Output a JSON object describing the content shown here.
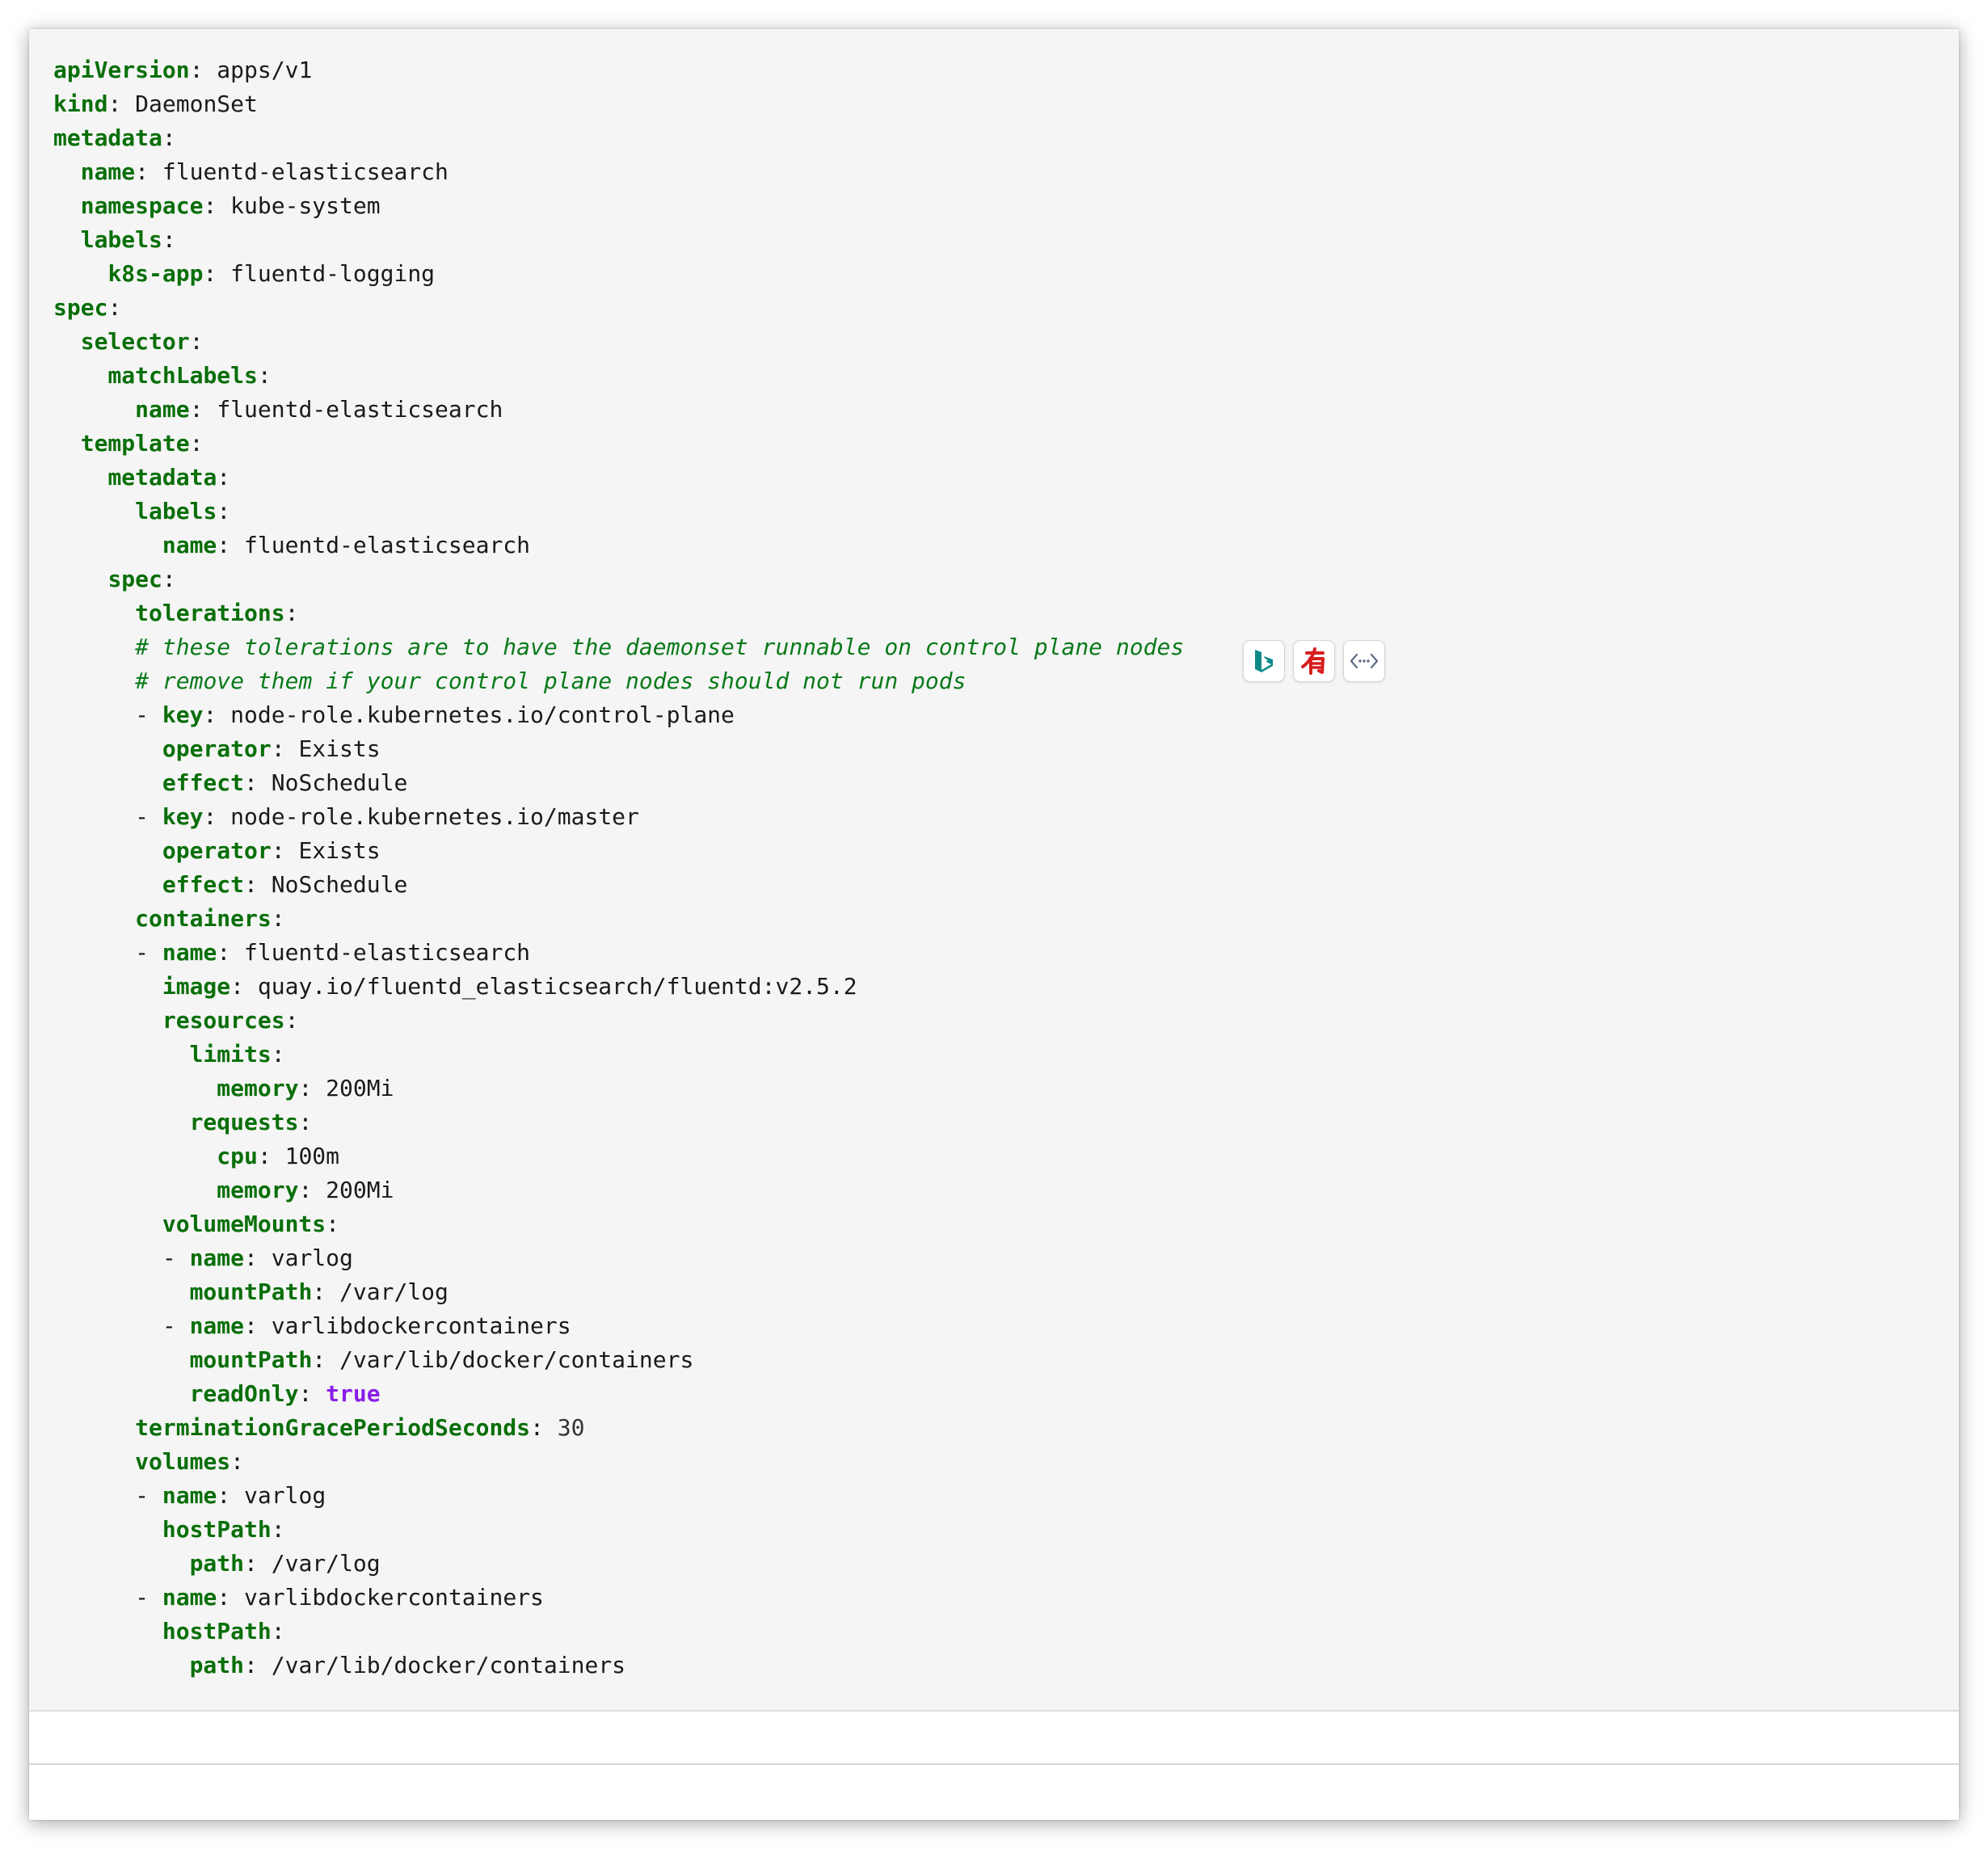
{
  "code": {
    "language": "yaml",
    "lines": [
      {
        "indent": "",
        "dash": "",
        "key": "apiVersion",
        "sep": ": ",
        "value": "apps/v1",
        "value_type": "str"
      },
      {
        "indent": "",
        "dash": "",
        "key": "kind",
        "sep": ": ",
        "value": "DaemonSet",
        "value_type": "str"
      },
      {
        "indent": "",
        "dash": "",
        "key": "metadata",
        "sep": ":",
        "value": "",
        "value_type": "str"
      },
      {
        "indent": "  ",
        "dash": "",
        "key": "name",
        "sep": ": ",
        "value": "fluentd-elasticsearch",
        "value_type": "str"
      },
      {
        "indent": "  ",
        "dash": "",
        "key": "namespace",
        "sep": ": ",
        "value": "kube-system",
        "value_type": "str"
      },
      {
        "indent": "  ",
        "dash": "",
        "key": "labels",
        "sep": ":",
        "value": "",
        "value_type": "str"
      },
      {
        "indent": "    ",
        "dash": "",
        "key": "k8s-app",
        "sep": ": ",
        "value": "fluentd-logging",
        "value_type": "str"
      },
      {
        "indent": "",
        "dash": "",
        "key": "spec",
        "sep": ":",
        "value": "",
        "value_type": "str"
      },
      {
        "indent": "  ",
        "dash": "",
        "key": "selector",
        "sep": ":",
        "value": "",
        "value_type": "str"
      },
      {
        "indent": "    ",
        "dash": "",
        "key": "matchLabels",
        "sep": ":",
        "value": "",
        "value_type": "str"
      },
      {
        "indent": "      ",
        "dash": "",
        "key": "name",
        "sep": ": ",
        "value": "fluentd-elasticsearch",
        "value_type": "str"
      },
      {
        "indent": "  ",
        "dash": "",
        "key": "template",
        "sep": ":",
        "value": "",
        "value_type": "str"
      },
      {
        "indent": "    ",
        "dash": "",
        "key": "metadata",
        "sep": ":",
        "value": "",
        "value_type": "str"
      },
      {
        "indent": "      ",
        "dash": "",
        "key": "labels",
        "sep": ":",
        "value": "",
        "value_type": "str"
      },
      {
        "indent": "        ",
        "dash": "",
        "key": "name",
        "sep": ": ",
        "value": "fluentd-elasticsearch",
        "value_type": "str"
      },
      {
        "indent": "    ",
        "dash": "",
        "key": "spec",
        "sep": ":",
        "value": "",
        "value_type": "str"
      },
      {
        "indent": "      ",
        "dash": "",
        "key": "tolerations",
        "sep": ":",
        "value": "",
        "value_type": "str"
      },
      {
        "indent": "      ",
        "comment": "# these tolerations are to have the daemonset runnable on control plane nodes"
      },
      {
        "indent": "      ",
        "comment": "# remove them if your control plane nodes should not run pods"
      },
      {
        "indent": "      ",
        "dash": "- ",
        "key": "key",
        "sep": ": ",
        "value": "node-role.kubernetes.io/control-plane",
        "value_type": "str"
      },
      {
        "indent": "        ",
        "dash": "",
        "key": "operator",
        "sep": ": ",
        "value": "Exists",
        "value_type": "str"
      },
      {
        "indent": "        ",
        "dash": "",
        "key": "effect",
        "sep": ": ",
        "value": "NoSchedule",
        "value_type": "str"
      },
      {
        "indent": "      ",
        "dash": "- ",
        "key": "key",
        "sep": ": ",
        "value": "node-role.kubernetes.io/master",
        "value_type": "str"
      },
      {
        "indent": "        ",
        "dash": "",
        "key": "operator",
        "sep": ": ",
        "value": "Exists",
        "value_type": "str"
      },
      {
        "indent": "        ",
        "dash": "",
        "key": "effect",
        "sep": ": ",
        "value": "NoSchedule",
        "value_type": "str"
      },
      {
        "indent": "      ",
        "dash": "",
        "key": "containers",
        "sep": ":",
        "value": "",
        "value_type": "str"
      },
      {
        "indent": "      ",
        "dash": "- ",
        "key": "name",
        "sep": ": ",
        "value": "fluentd-elasticsearch",
        "value_type": "str"
      },
      {
        "indent": "        ",
        "dash": "",
        "key": "image",
        "sep": ": ",
        "value": "quay.io/fluentd_elasticsearch/fluentd:v2.5.2",
        "value_type": "str"
      },
      {
        "indent": "        ",
        "dash": "",
        "key": "resources",
        "sep": ":",
        "value": "",
        "value_type": "str"
      },
      {
        "indent": "          ",
        "dash": "",
        "key": "limits",
        "sep": ":",
        "value": "",
        "value_type": "str"
      },
      {
        "indent": "            ",
        "dash": "",
        "key": "memory",
        "sep": ": ",
        "value": "200Mi",
        "value_type": "str"
      },
      {
        "indent": "          ",
        "dash": "",
        "key": "requests",
        "sep": ":",
        "value": "",
        "value_type": "str"
      },
      {
        "indent": "            ",
        "dash": "",
        "key": "cpu",
        "sep": ": ",
        "value": "100m",
        "value_type": "str"
      },
      {
        "indent": "            ",
        "dash": "",
        "key": "memory",
        "sep": ": ",
        "value": "200Mi",
        "value_type": "str"
      },
      {
        "indent": "        ",
        "dash": "",
        "key": "volumeMounts",
        "sep": ":",
        "value": "",
        "value_type": "str"
      },
      {
        "indent": "        ",
        "dash": "- ",
        "key": "name",
        "sep": ": ",
        "value": "varlog",
        "value_type": "str"
      },
      {
        "indent": "          ",
        "dash": "",
        "key": "mountPath",
        "sep": ": ",
        "value": "/var/log",
        "value_type": "str"
      },
      {
        "indent": "        ",
        "dash": "- ",
        "key": "name",
        "sep": ": ",
        "value": "varlibdockercontainers",
        "value_type": "str"
      },
      {
        "indent": "          ",
        "dash": "",
        "key": "mountPath",
        "sep": ": ",
        "value": "/var/lib/docker/containers",
        "value_type": "str"
      },
      {
        "indent": "          ",
        "dash": "",
        "key": "readOnly",
        "sep": ": ",
        "value": "true",
        "value_type": "bool"
      },
      {
        "indent": "      ",
        "dash": "",
        "key": "terminationGracePeriodSeconds",
        "sep": ": ",
        "value": "30",
        "value_type": "num"
      },
      {
        "indent": "      ",
        "dash": "",
        "key": "volumes",
        "sep": ":",
        "value": "",
        "value_type": "str"
      },
      {
        "indent": "      ",
        "dash": "- ",
        "key": "name",
        "sep": ": ",
        "value": "varlog",
        "value_type": "str"
      },
      {
        "indent": "        ",
        "dash": "",
        "key": "hostPath",
        "sep": ":",
        "value": "",
        "value_type": "str"
      },
      {
        "indent": "          ",
        "dash": "",
        "key": "path",
        "sep": ": ",
        "value": "/var/log",
        "value_type": "str"
      },
      {
        "indent": "      ",
        "dash": "- ",
        "key": "name",
        "sep": ": ",
        "value": "varlibdockercontainers",
        "value_type": "str"
      },
      {
        "indent": "        ",
        "dash": "",
        "key": "hostPath",
        "sep": ":",
        "value": "",
        "value_type": "str"
      },
      {
        "indent": "          ",
        "dash": "",
        "key": "path",
        "sep": ": ",
        "value": "/var/lib/docker/containers",
        "value_type": "str"
      }
    ]
  },
  "toolbar": {
    "buttons": [
      {
        "icon": "bing-translate-icon",
        "color": "#0f8a8a"
      },
      {
        "icon": "youdao-dictionary-icon",
        "color": "#d81e1e"
      },
      {
        "icon": "code-view-icon",
        "color": "#5d6b80"
      }
    ]
  },
  "colors": {
    "code_background": "#f5f5f5",
    "key": "#0a6f0a",
    "comment": "#0a7a1a",
    "boolean": "#8a1ee8",
    "text": "#1a1a1a"
  }
}
